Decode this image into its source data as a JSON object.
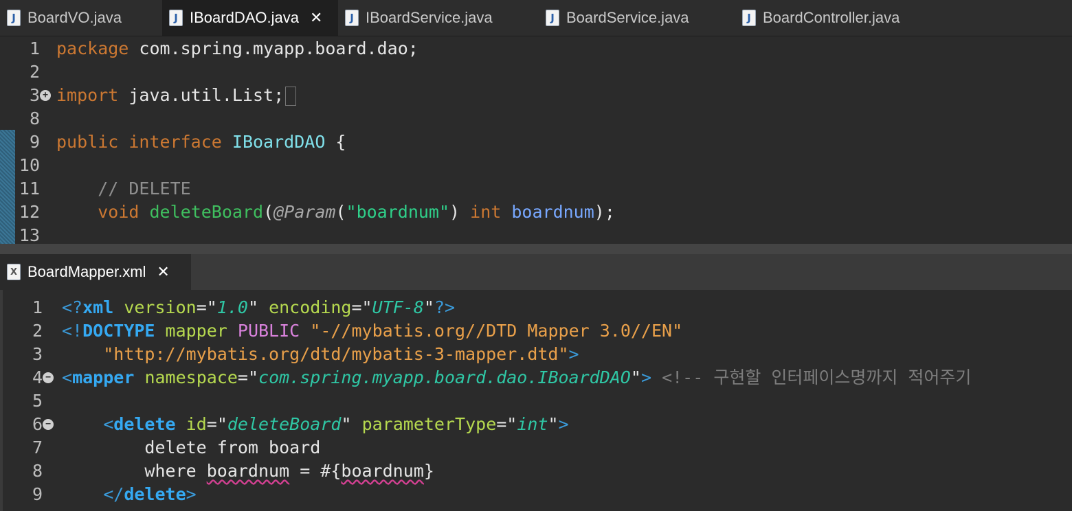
{
  "top_tabs": [
    {
      "label": "BoardVO.java",
      "active": false
    },
    {
      "label": "IBoardDAO.java",
      "active": true
    },
    {
      "label": "IBoardService.java",
      "active": false
    },
    {
      "label": "BoardService.java",
      "active": false
    },
    {
      "label": "BoardController.java",
      "active": false
    }
  ],
  "java_editor": {
    "lines": [
      {
        "num": "1",
        "tokens": [
          {
            "c": "kw",
            "t": "package"
          },
          {
            "c": "",
            "t": " com.spring.myapp.board.dao;"
          }
        ]
      },
      {
        "num": "2",
        "tokens": []
      },
      {
        "num": "3",
        "tokens": [
          {
            "c": "kw",
            "t": "import"
          },
          {
            "c": "",
            "t": " java.util.List;"
          }
        ]
      },
      {
        "num": "8",
        "tokens": []
      },
      {
        "num": "9",
        "tokens": [
          {
            "c": "kw",
            "t": "public"
          },
          {
            "c": "",
            "t": " "
          },
          {
            "c": "kw",
            "t": "interface"
          },
          {
            "c": "",
            "t": " "
          },
          {
            "c": "type",
            "t": "IBoardDAO"
          },
          {
            "c": "",
            "t": " {"
          }
        ]
      },
      {
        "num": "10",
        "tokens": []
      },
      {
        "num": "11",
        "tokens": [
          {
            "c": "",
            "t": "    "
          },
          {
            "c": "cmt",
            "t": "// DELETE"
          }
        ]
      },
      {
        "num": "12",
        "tokens": [
          {
            "c": "",
            "t": "    "
          },
          {
            "c": "kw",
            "t": "void"
          },
          {
            "c": "",
            "t": " "
          },
          {
            "c": "fn",
            "t": "deleteBoard"
          },
          {
            "c": "",
            "t": "("
          },
          {
            "c": "anno",
            "t": "@Param"
          },
          {
            "c": "",
            "t": "("
          },
          {
            "c": "str",
            "t": "\"boardnum\""
          },
          {
            "c": "",
            "t": ") "
          },
          {
            "c": "kw",
            "t": "int"
          },
          {
            "c": "",
            "t": " "
          },
          {
            "c": "param",
            "t": "boardnum"
          },
          {
            "c": "",
            "t": ");"
          }
        ]
      },
      {
        "num": "13",
        "tokens": []
      }
    ]
  },
  "bottom_tab": {
    "label": "BoardMapper.xml"
  },
  "xml_editor": {
    "lines": [
      {
        "num": "1",
        "tokens": [
          {
            "c": "x-br",
            "t": "<?"
          },
          {
            "c": "x-tag",
            "t": "xml"
          },
          {
            "c": "",
            "t": " "
          },
          {
            "c": "x-att",
            "t": "version"
          },
          {
            "c": "x-q",
            "t": "=\""
          },
          {
            "c": "x-val",
            "t": "1.0"
          },
          {
            "c": "x-q",
            "t": "\""
          },
          {
            "c": "",
            "t": " "
          },
          {
            "c": "x-att",
            "t": "encoding"
          },
          {
            "c": "x-q",
            "t": "=\""
          },
          {
            "c": "x-val",
            "t": "UTF-8"
          },
          {
            "c": "x-q",
            "t": "\""
          },
          {
            "c": "x-br",
            "t": "?>"
          }
        ]
      },
      {
        "num": "2",
        "tokens": [
          {
            "c": "x-br",
            "t": "<!"
          },
          {
            "c": "x-doc",
            "t": "DOCTYPE"
          },
          {
            "c": "",
            "t": " "
          },
          {
            "c": "x-att",
            "t": "mapper"
          },
          {
            "c": "",
            "t": " "
          },
          {
            "c": "x-pub",
            "t": "PUBLIC"
          },
          {
            "c": "",
            "t": " "
          },
          {
            "c": "x-dtd",
            "t": "\"-//mybatis.org//DTD Mapper 3.0//EN\""
          }
        ]
      },
      {
        "num": "3",
        "tokens": [
          {
            "c": "",
            "t": "    "
          },
          {
            "c": "x-dtd",
            "t": "\"http://mybatis.org/dtd/mybatis-3-mapper.dtd\""
          },
          {
            "c": "x-br",
            "t": ">"
          }
        ]
      },
      {
        "num": "4",
        "tokens": [
          {
            "c": "x-br",
            "t": "<"
          },
          {
            "c": "x-tag",
            "t": "mapper"
          },
          {
            "c": "",
            "t": " "
          },
          {
            "c": "x-att",
            "t": "namespace"
          },
          {
            "c": "x-q",
            "t": "=\""
          },
          {
            "c": "x-val",
            "t": "com.spring.myapp.board.dao.IBoardDAO"
          },
          {
            "c": "x-q",
            "t": "\""
          },
          {
            "c": "x-br",
            "t": ">"
          },
          {
            "c": "",
            "t": " "
          },
          {
            "c": "x-cmt",
            "t": "<!-- 구현할 인터페이스명까지 적어주기"
          }
        ]
      },
      {
        "num": "5",
        "tokens": []
      },
      {
        "num": "6",
        "tokens": [
          {
            "c": "",
            "t": "    "
          },
          {
            "c": "x-br",
            "t": "<"
          },
          {
            "c": "x-tag",
            "t": "delete"
          },
          {
            "c": "",
            "t": " "
          },
          {
            "c": "x-att",
            "t": "id"
          },
          {
            "c": "x-q",
            "t": "=\""
          },
          {
            "c": "x-val",
            "t": "deleteBoard"
          },
          {
            "c": "x-q",
            "t": "\""
          },
          {
            "c": "",
            "t": " "
          },
          {
            "c": "x-att",
            "t": "parameterType"
          },
          {
            "c": "x-q",
            "t": "=\""
          },
          {
            "c": "x-val",
            "t": "int"
          },
          {
            "c": "x-q",
            "t": "\""
          },
          {
            "c": "x-br",
            "t": ">"
          }
        ]
      },
      {
        "num": "7",
        "tokens": [
          {
            "c": "",
            "t": "        delete from board"
          }
        ]
      },
      {
        "num": "8",
        "tokens": [
          {
            "c": "",
            "t": "        where "
          },
          {
            "c": "squiggle",
            "t": "boardnum"
          },
          {
            "c": "",
            "t": " = #{"
          },
          {
            "c": "squiggle",
            "t": "boardnum"
          },
          {
            "c": "",
            "t": "}"
          }
        ]
      },
      {
        "num": "9",
        "tokens": [
          {
            "c": "",
            "t": "    "
          },
          {
            "c": "x-br",
            "t": "</"
          },
          {
            "c": "x-tag",
            "t": "delete"
          },
          {
            "c": "x-br",
            "t": ">"
          }
        ]
      }
    ]
  }
}
